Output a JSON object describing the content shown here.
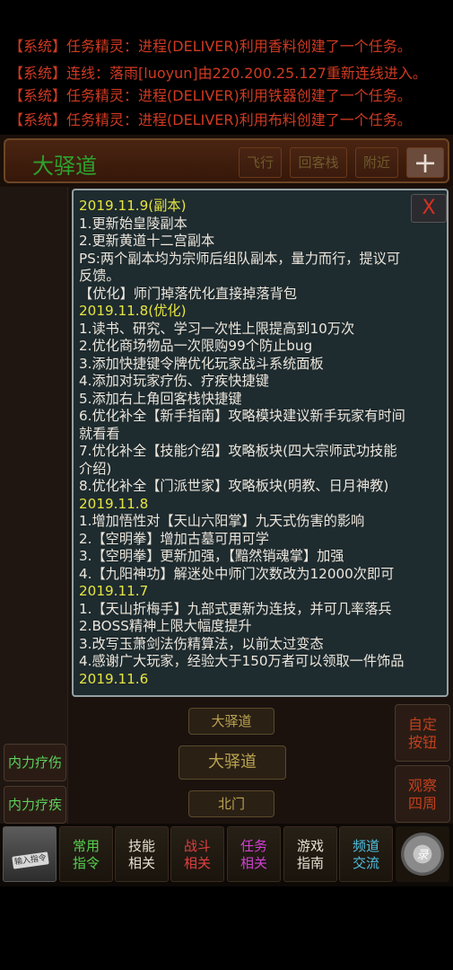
{
  "system_log": [
    {
      "tag": "【系统】",
      "msg": "任务精灵：进程(DELIVER)利用香料创建了一个任务。"
    },
    {
      "tag": "【系统】",
      "msg": "连线：落雨[luoyun]由220.200.25.127重新连线进入。"
    },
    {
      "tag": "【系统】",
      "msg": "任务精灵：进程(DELIVER)利用铁器创建了一个任务。"
    },
    {
      "tag": "【系统】",
      "msg": "任务精灵：进程(DELIVER)利用布料创建了一个任务。"
    }
  ],
  "location_bar": {
    "name": "大驿道",
    "fly": "飞行",
    "inn": "回客栈",
    "nearby": "附近",
    "plus": "+"
  },
  "announcement": {
    "close": "X",
    "rows": [
      {
        "text": "2019.11.9(副本)",
        "type": "date"
      },
      {
        "text": "1.更新始皇陵副本",
        "type": "text"
      },
      {
        "text": "2.更新黄道十二宫副本",
        "type": "text"
      },
      {
        "text": "PS:两个副本均为宗师后组队副本，量力而行，提议可",
        "type": "text"
      },
      {
        "text": "反馈。",
        "type": "text"
      },
      {
        "text": "【优化】师门掉落优化直接掉落背包",
        "type": "text"
      },
      {
        "text": "2019.11.8(优化)",
        "type": "date"
      },
      {
        "text": "1.读书、研究、学习一次性上限提高到10万次",
        "type": "text"
      },
      {
        "text": "2.优化商场物品一次限购99个防止bug",
        "type": "text"
      },
      {
        "text": "3.添加快捷键令牌优化玩家战斗系统面板",
        "type": "text"
      },
      {
        "text": "4.添加对玩家疗伤、疗疾快捷键",
        "type": "text"
      },
      {
        "text": "5.添加右上角回客栈快捷键",
        "type": "text"
      },
      {
        "text": "6.优化补全【新手指南】攻略模块建议新手玩家有时间",
        "type": "text"
      },
      {
        "text": "就看看",
        "type": "text"
      },
      {
        "text": "7.优化补全【技能介绍】攻略板块(四大宗师武功技能",
        "type": "text"
      },
      {
        "text": "介绍)",
        "type": "text"
      },
      {
        "text": "8.优化补全【门派世家】攻略板块(明教、日月神教)",
        "type": "text"
      },
      {
        "text": "2019.11.8",
        "type": "date"
      },
      {
        "text": "1.增加悟性对【天山六阳掌】九天式伤害的影响",
        "type": "text"
      },
      {
        "text": "2.【空明拳】增加古墓可用可学",
        "type": "text"
      },
      {
        "text": "3.【空明拳】更新加强，【黯然销魂掌】加强",
        "type": "text"
      },
      {
        "text": "4.【九阳神功】解迷处中师门次数改为12000次即可",
        "type": "text"
      },
      {
        "text": "2019.11.7",
        "type": "date"
      },
      {
        "text": "1.【天山折梅手】九部式更新为连技，并可几率落兵",
        "type": "text"
      },
      {
        "text": "2.BOSS精神上限大幅度提升",
        "type": "text"
      },
      {
        "text": "3.改写玉萧剑法伤精算法，以前太过变态",
        "type": "text"
      },
      {
        "text": "4.感谢广大玩家，经验大于150万者可以领取一件饰品",
        "type": "text"
      },
      {
        "text": "2019.11.6",
        "type": "date"
      }
    ]
  },
  "exits": {
    "north_road": "大驿道",
    "current": "大驿道",
    "north_gate": "北门"
  },
  "side_buttons": {
    "heal_injury": "内力疗伤",
    "heal_disease": "内力疗疾"
  },
  "right_buttons": {
    "custom": [
      "自定",
      "按钮"
    ],
    "observe": [
      "观察",
      "四周"
    ]
  },
  "bottom_bar": {
    "input_label": "输入指令",
    "items": [
      {
        "line1": "常用",
        "line2": "指令",
        "color": "#56d04e"
      },
      {
        "line1": "技能",
        "line2": "相关",
        "color": "#e8e0d0"
      },
      {
        "line1": "战斗",
        "line2": "相关",
        "color": "#e04040"
      },
      {
        "line1": "任务",
        "line2": "相关",
        "color": "#d040d0"
      },
      {
        "line1": "游戏",
        "line2": "指南",
        "color": "#e8e0d0"
      },
      {
        "line1": "频道",
        "line2": "交流",
        "color": "#50c0e0"
      }
    ],
    "gear_label": "录"
  }
}
